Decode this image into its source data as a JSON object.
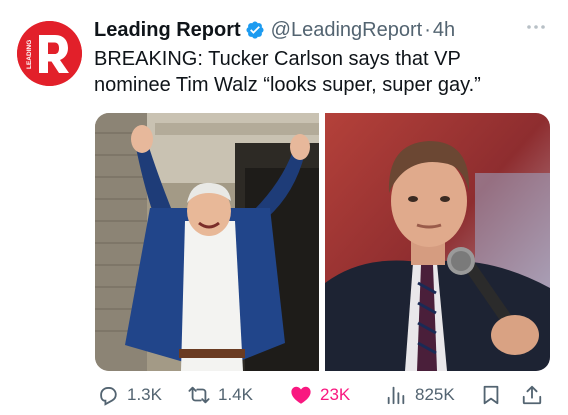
{
  "post": {
    "author_name": "Leading Report",
    "handle": "@LeadingReport",
    "separator": "·",
    "time": "4h",
    "avatar": {
      "letter": "R",
      "small_text": "LEADING",
      "color": "#e2202a"
    },
    "text_lines": [
      "BREAKING: Tucker Carlson says that VP",
      "nominee Tim Walz “looks super, super gay.”"
    ]
  },
  "metrics": {
    "replies": "1.3K",
    "reposts": "1.4K",
    "likes": "23K",
    "views": "825K"
  },
  "colors": {
    "text": "#0f1419",
    "secondary": "#536471",
    "verified": "#1d9bf0",
    "like": "#f91880",
    "brand_red": "#e2202a"
  },
  "icons": {
    "verified": "verified-badge-icon",
    "more": "more-dots-icon",
    "reply": "reply-icon",
    "repost": "repost-icon",
    "like": "heart-icon",
    "views": "views-chart-icon",
    "bookmark": "bookmark-icon",
    "share": "share-icon"
  }
}
